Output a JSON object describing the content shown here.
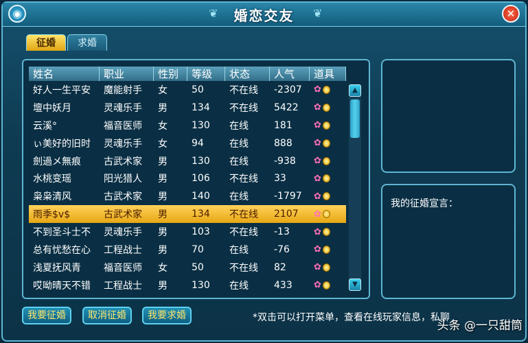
{
  "window": {
    "title": "婚恋交友"
  },
  "tabs": [
    {
      "label": "征婚",
      "active": true
    },
    {
      "label": "求婚",
      "active": false
    }
  ],
  "table": {
    "headers": [
      "姓名",
      "职业",
      "性别",
      "等级",
      "状态",
      "人气",
      "道具"
    ],
    "rows": [
      [
        "好人一生平安",
        "魔能射手",
        "女",
        "50",
        "不在线",
        "-2307"
      ],
      [
        "壇中妖月",
        "灵魂乐手",
        "男",
        "134",
        "不在线",
        "5422"
      ],
      [
        "云溪°",
        "福音医师",
        "女",
        "130",
        "在线",
        "181"
      ],
      [
        "ぃ美好的旧时",
        "灵魂乐手",
        "女",
        "94",
        "在线",
        "888"
      ],
      [
        "劍過メ無痕",
        "古武术家",
        "男",
        "130",
        "在线",
        "-938"
      ],
      [
        "水桃变瑶",
        "阳光猎人",
        "男",
        "106",
        "不在线",
        "33"
      ],
      [
        "枭枭清风",
        "古武术家",
        "男",
        "140",
        "在线",
        "-1797"
      ],
      [
        "雨季$v$",
        "古武术家",
        "男",
        "134",
        "不在线",
        "2107"
      ],
      [
        "不到圣斗士不",
        "灵魂乐手",
        "男",
        "103",
        "不在线",
        "-13"
      ],
      [
        "总有忧愁在心",
        "工程战士",
        "男",
        "70",
        "在线",
        "-76"
      ],
      [
        "浅夏抚风青",
        "福音医师",
        "女",
        "50",
        "不在线",
        "82"
      ],
      [
        "哎呦晴天不错",
        "工程战士",
        "男",
        "130",
        "在线",
        "433"
      ]
    ],
    "selected_index": 7
  },
  "side": {
    "declaration_label": "我的征婚宣言："
  },
  "buttons": {
    "apply": "我要征婚",
    "cancel": "取消征婚",
    "propose": "我要求婚"
  },
  "hint": "*双击可以打开菜单，查看在线玩家信息，私聊",
  "watermark": "头条 @一只甜筒",
  "icons": {
    "tool_1": "flower-icon",
    "tool_2": "coin-icon",
    "menu": "menu-orb-icon",
    "close": "close-icon"
  },
  "colors": {
    "selected_row": "#e7a714",
    "accent": "#5fb6d3"
  }
}
